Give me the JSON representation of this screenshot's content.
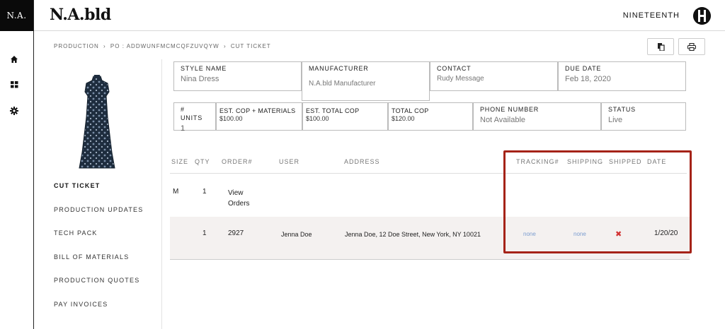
{
  "brand": {
    "logo_short": "N.A.",
    "name": "N.A.bld"
  },
  "user": {
    "name": "NINETEENTH"
  },
  "breadcrumb": [
    "PRODUCTION",
    "›",
    "PO : ADDWUNFMCMCQFZUVQYW",
    "›",
    "CUT TICKET"
  ],
  "info": {
    "style_name": {
      "label": "STYLE NAME",
      "value": "Nina Dress"
    },
    "manufacturer": {
      "label": "MANUFACTURER",
      "value": "N.A.bld Manufacturer"
    },
    "contact": {
      "label": "CONTACT",
      "value": "Rudy Message"
    },
    "due_date": {
      "label": "DUE DATE",
      "value": "Feb 18, 2020"
    },
    "units": {
      "label": "# UNITS",
      "value": "1"
    },
    "est_cop_materials": {
      "label": "EST. COP + MATERIALS",
      "value": "$100.00"
    },
    "est_total_cop": {
      "label": "EST. TOTAL COP",
      "value": "$100.00"
    },
    "total_cop": {
      "label": "TOTAL COP",
      "value": "$120.00"
    },
    "phone": {
      "label": "PHONE NUMBER",
      "value": "Not Available"
    },
    "status": {
      "label": "STATUS",
      "value": "Live"
    }
  },
  "sidenav": [
    "CUT TICKET",
    "PRODUCTION UPDATES",
    "TECH PACK",
    "BILL OF MATERIALS",
    "PRODUCTION QUOTES",
    "PAY INVOICES"
  ],
  "table": {
    "headers": [
      "SIZE",
      "QTY",
      "ORDER#",
      "USER",
      "ADDRESS",
      "TRACKING#",
      "SHIPPING",
      "SHIPPED",
      "DATE"
    ],
    "summary_row": {
      "size": "M",
      "qty": "1",
      "orders_line1": "View",
      "orders_line2": "Orders"
    },
    "order_row": {
      "qty": "1",
      "order": "2927",
      "user": "Jenna Doe",
      "address": "Jenna Doe, 12 Doe Street, New York, NY 10021",
      "tracking": "none",
      "shipping": "none",
      "shipped": "✖",
      "date": "1/20/20"
    }
  },
  "colors": {
    "highlight": "#a52318",
    "link": "#7a9ccf",
    "shipped_no": "#d23232",
    "row_bg": "#f4f1f0"
  },
  "icons": [
    "home-icon",
    "grid-icon",
    "gear-icon",
    "copy-icon",
    "print-icon"
  ]
}
